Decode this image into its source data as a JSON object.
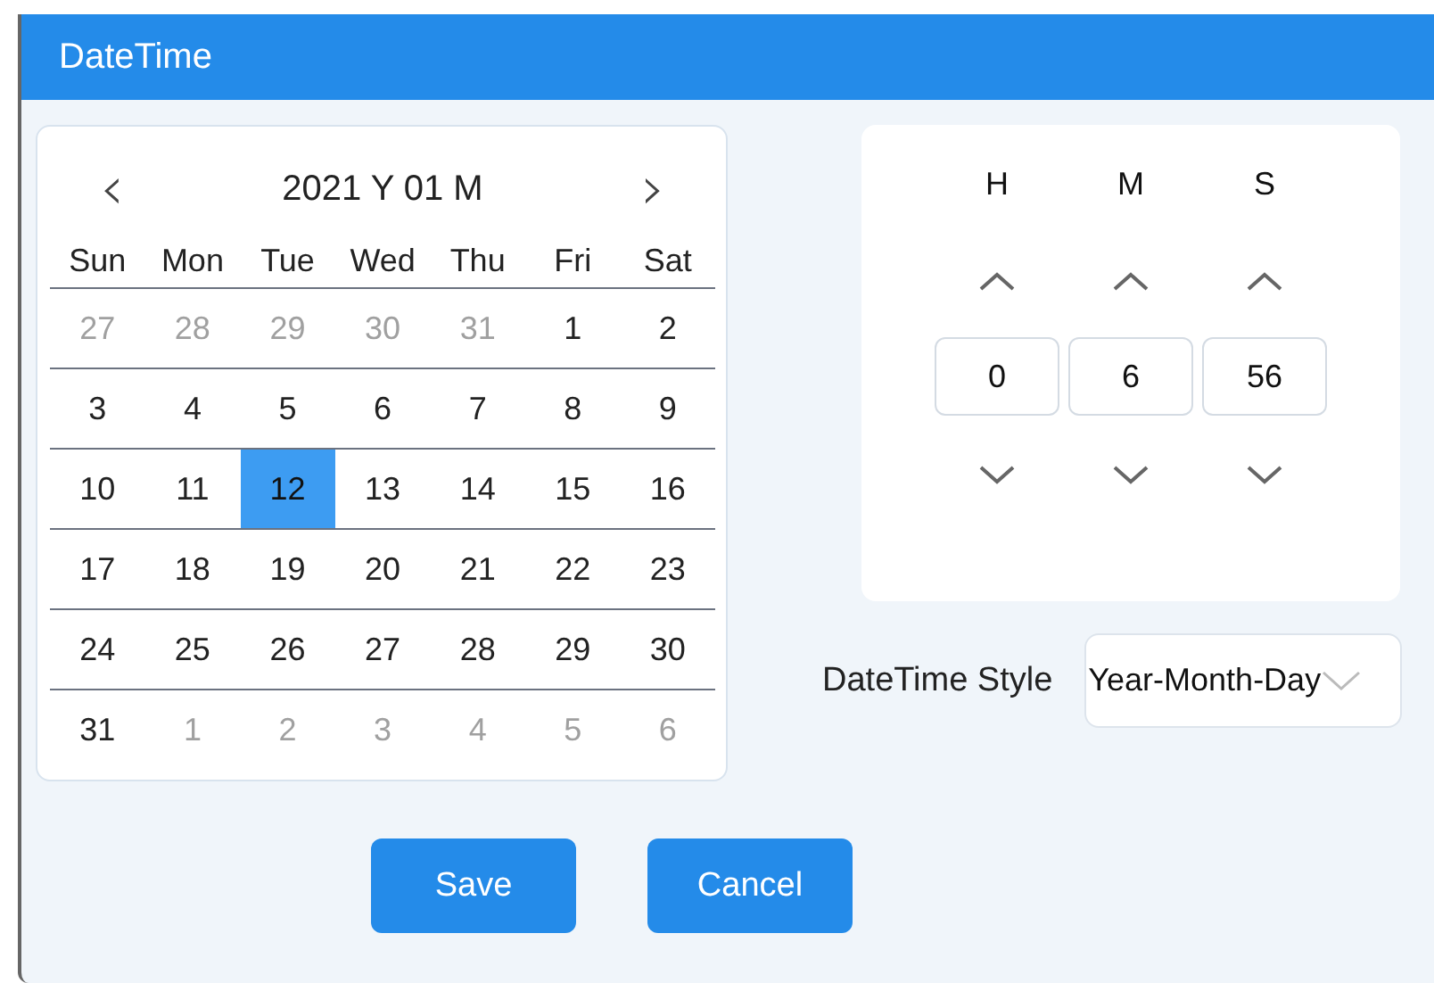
{
  "window": {
    "title": "DateTime"
  },
  "calendar": {
    "prev": "‹",
    "next": "›",
    "heading": "2021 Y 01 M",
    "weekdays": [
      "Sun",
      "Mon",
      "Tue",
      "Wed",
      "Thu",
      "Fri",
      "Sat"
    ],
    "weeks": [
      [
        {
          "label": "27",
          "muted": true,
          "selected": false
        },
        {
          "label": "28",
          "muted": true,
          "selected": false
        },
        {
          "label": "29",
          "muted": true,
          "selected": false
        },
        {
          "label": "30",
          "muted": true,
          "selected": false
        },
        {
          "label": "31",
          "muted": true,
          "selected": false
        },
        {
          "label": "1",
          "muted": false,
          "selected": false
        },
        {
          "label": "2",
          "muted": false,
          "selected": false
        }
      ],
      [
        {
          "label": "3",
          "muted": false,
          "selected": false
        },
        {
          "label": "4",
          "muted": false,
          "selected": false
        },
        {
          "label": "5",
          "muted": false,
          "selected": false
        },
        {
          "label": "6",
          "muted": false,
          "selected": false
        },
        {
          "label": "7",
          "muted": false,
          "selected": false
        },
        {
          "label": "8",
          "muted": false,
          "selected": false
        },
        {
          "label": "9",
          "muted": false,
          "selected": false
        }
      ],
      [
        {
          "label": "10",
          "muted": false,
          "selected": false
        },
        {
          "label": "11",
          "muted": false,
          "selected": false
        },
        {
          "label": "12",
          "muted": false,
          "selected": true
        },
        {
          "label": "13",
          "muted": false,
          "selected": false
        },
        {
          "label": "14",
          "muted": false,
          "selected": false
        },
        {
          "label": "15",
          "muted": false,
          "selected": false
        },
        {
          "label": "16",
          "muted": false,
          "selected": false
        }
      ],
      [
        {
          "label": "17",
          "muted": false,
          "selected": false
        },
        {
          "label": "18",
          "muted": false,
          "selected": false
        },
        {
          "label": "19",
          "muted": false,
          "selected": false
        },
        {
          "label": "20",
          "muted": false,
          "selected": false
        },
        {
          "label": "21",
          "muted": false,
          "selected": false
        },
        {
          "label": "22",
          "muted": false,
          "selected": false
        },
        {
          "label": "23",
          "muted": false,
          "selected": false
        }
      ],
      [
        {
          "label": "24",
          "muted": false,
          "selected": false
        },
        {
          "label": "25",
          "muted": false,
          "selected": false
        },
        {
          "label": "26",
          "muted": false,
          "selected": false
        },
        {
          "label": "27",
          "muted": false,
          "selected": false
        },
        {
          "label": "28",
          "muted": false,
          "selected": false
        },
        {
          "label": "29",
          "muted": false,
          "selected": false
        },
        {
          "label": "30",
          "muted": false,
          "selected": false
        }
      ],
      [
        {
          "label": "31",
          "muted": false,
          "selected": false
        },
        {
          "label": "1",
          "muted": true,
          "selected": false
        },
        {
          "label": "2",
          "muted": true,
          "selected": false
        },
        {
          "label": "3",
          "muted": true,
          "selected": false
        },
        {
          "label": "4",
          "muted": true,
          "selected": false
        },
        {
          "label": "5",
          "muted": true,
          "selected": false
        },
        {
          "label": "6",
          "muted": true,
          "selected": false
        }
      ]
    ]
  },
  "time": [
    {
      "label": "H",
      "value": "0"
    },
    {
      "label": "M",
      "value": "6"
    },
    {
      "label": "S",
      "value": "56"
    }
  ],
  "style": {
    "label": "DateTime Style",
    "value": "Year-Month-Day"
  },
  "buttons": [
    "Save",
    "Cancel"
  ]
}
